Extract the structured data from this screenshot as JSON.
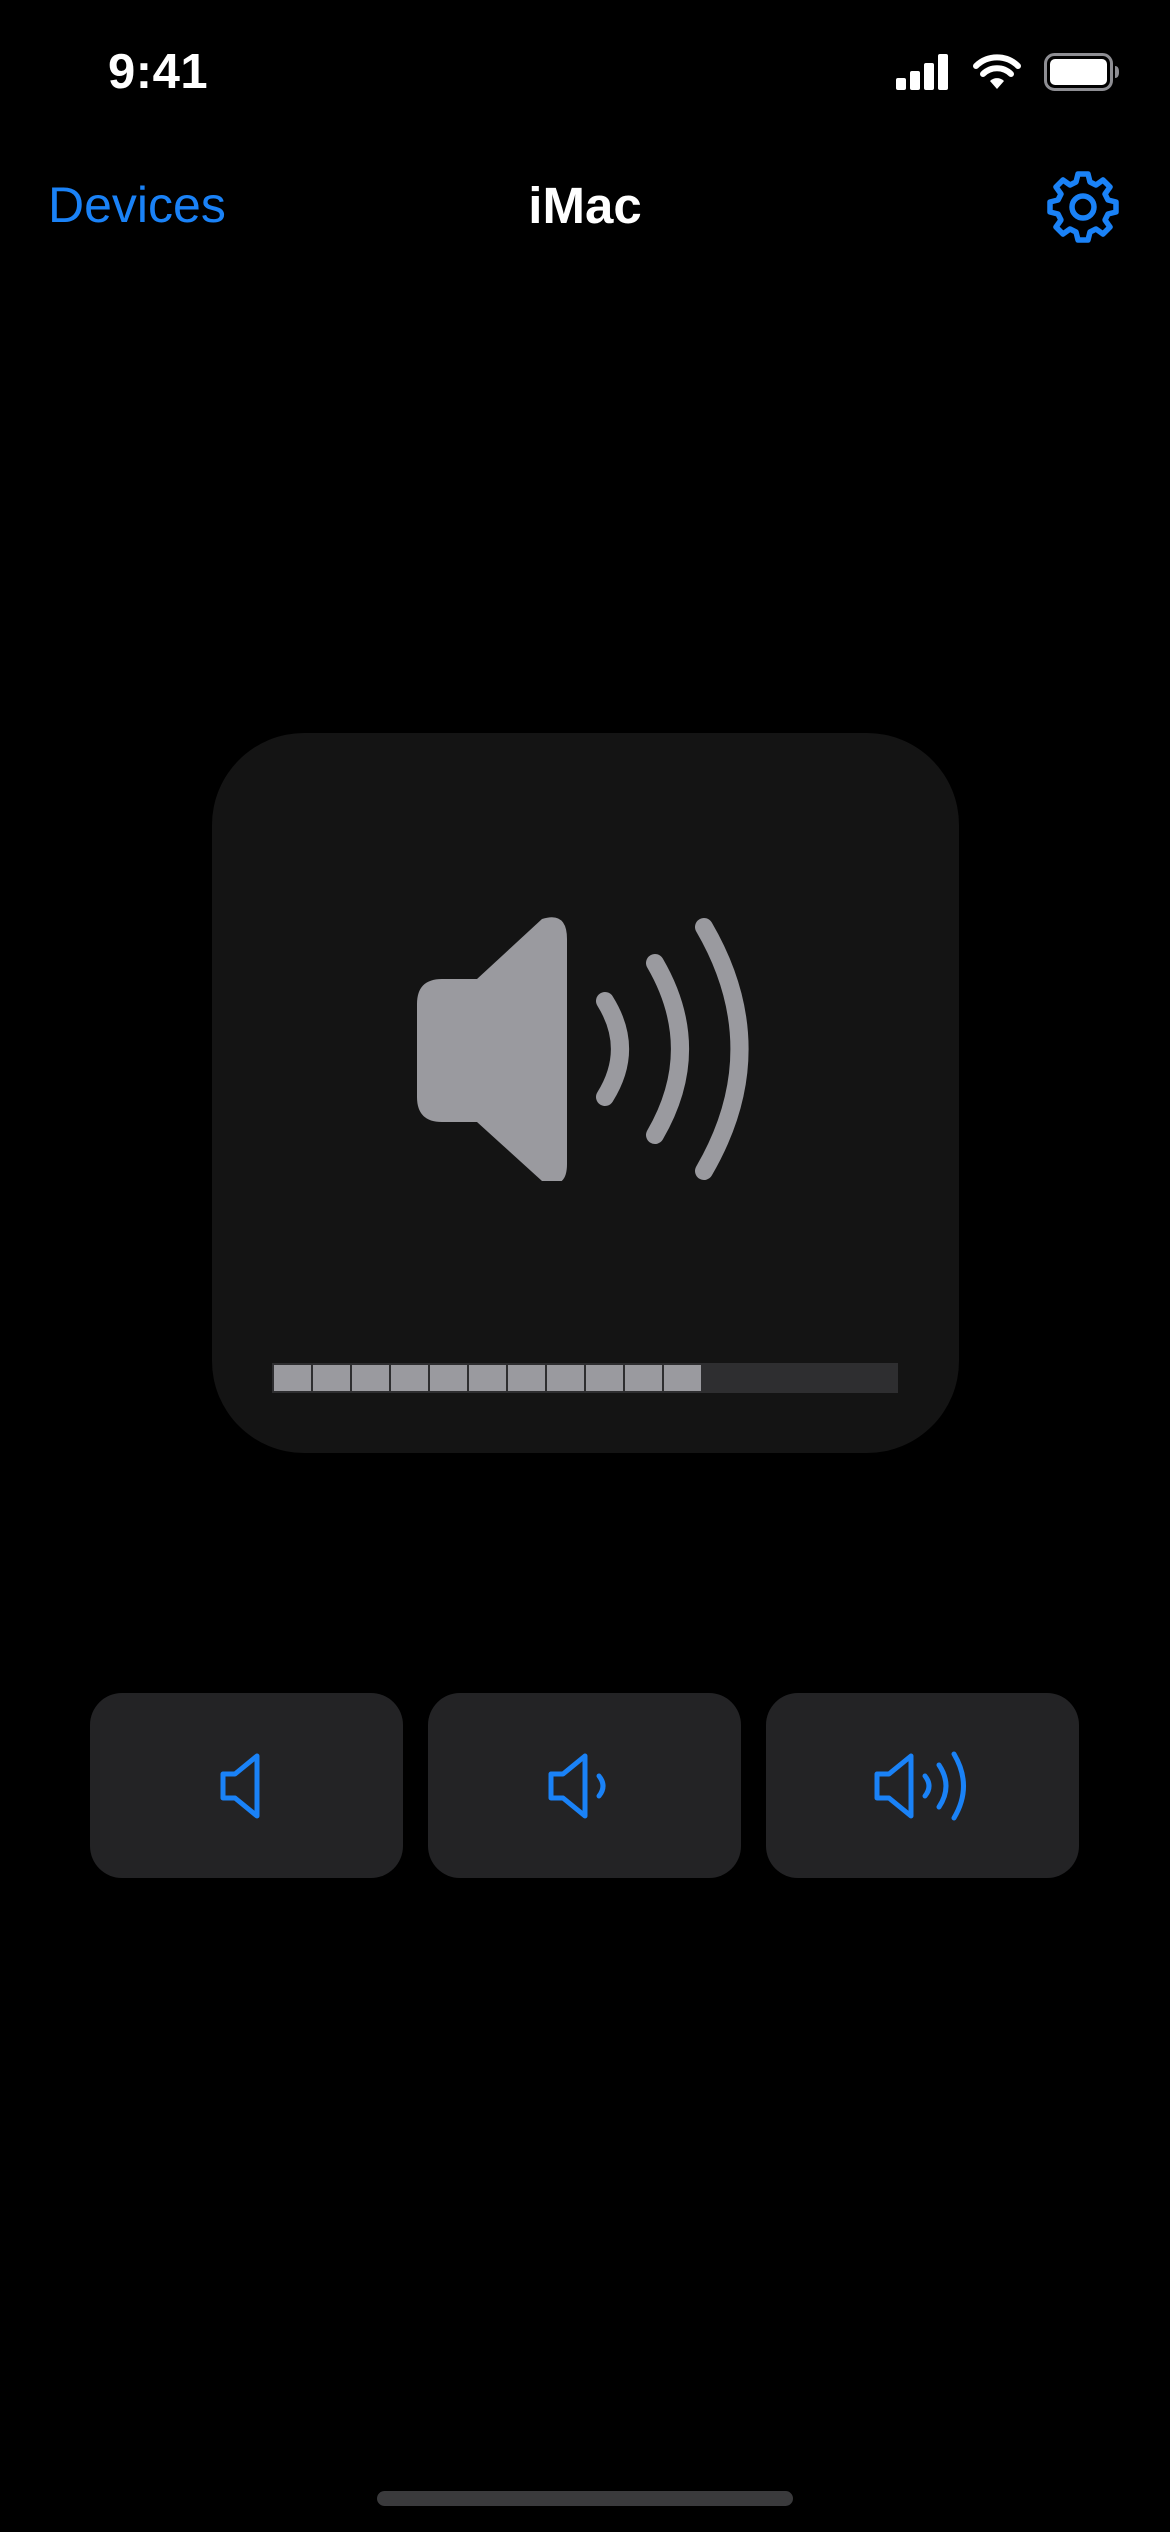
{
  "status_bar": {
    "time": "9:41",
    "icons": [
      "cellular-signal-icon",
      "wifi-icon",
      "battery-icon"
    ]
  },
  "nav": {
    "back_label": "Devices",
    "title": "iMac",
    "settings_icon": "gear-icon"
  },
  "hud": {
    "icon": "speaker-volume-high-icon",
    "volume_level": 0.6875,
    "segments_total": 16,
    "segments_filled": 11
  },
  "volume_buttons": [
    {
      "name": "volume-mute-button",
      "icon": "speaker-icon"
    },
    {
      "name": "volume-medium-button",
      "icon": "speaker-one-wave-icon"
    },
    {
      "name": "volume-max-button",
      "icon": "speaker-three-waves-icon"
    }
  ],
  "colors": {
    "accent": "#1a82f7",
    "background": "#000000",
    "card": "#141414",
    "button": "#232325",
    "glyph": "#9a9a9f"
  }
}
